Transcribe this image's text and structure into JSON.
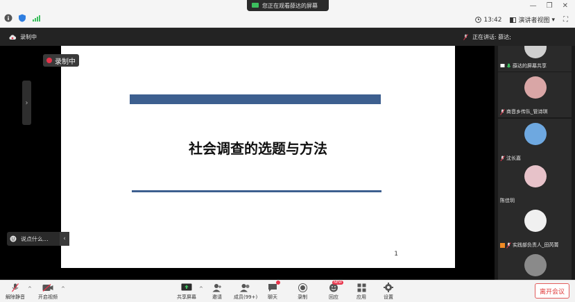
{
  "titlebar": {
    "watching_text": "您正在观看薛达的屏幕",
    "time": "13:42",
    "view_mode": "演讲者视图"
  },
  "statusbar": {
    "recording_label": "录制中",
    "speaking_label": "正在讲话: 薛达;"
  },
  "stage": {
    "recording_badge": "录制中",
    "chat_placeholder": "说点什么..."
  },
  "slide": {
    "title": "社会调查的选题与方法",
    "page_number": "1"
  },
  "gallery": {
    "participants": [
      {
        "name": "薛达的屏幕共享",
        "avatar_color": "#cfcfcf"
      },
      {
        "name": "商音乡传队_管诗琪",
        "avatar_color": "#d9a6a6"
      },
      {
        "name": "沈长嘉",
        "avatar_color": "#6ea8e0"
      },
      {
        "name": "陈佳玥",
        "avatar_color": "#e7c2c9"
      },
      {
        "name": "实践部负责人_田芮菁",
        "avatar_color": "#f0f0f0"
      },
      {
        "name": "",
        "avatar_color": "#8a8a8a"
      }
    ]
  },
  "toolbar": {
    "mute": "解除静音",
    "video": "开启视频",
    "share": "共享屏幕",
    "invite": "邀请",
    "members": "成员(99+)",
    "chat": "聊天",
    "record": "录制",
    "reactions": "回应",
    "apps": "应用",
    "settings": "设置",
    "leave": "离开会议",
    "new_badge": "NEW"
  },
  "colors": {
    "slide_accent": "#3d5f8f",
    "leave_red": "#e03a3a",
    "record_red": "#e8334a"
  }
}
